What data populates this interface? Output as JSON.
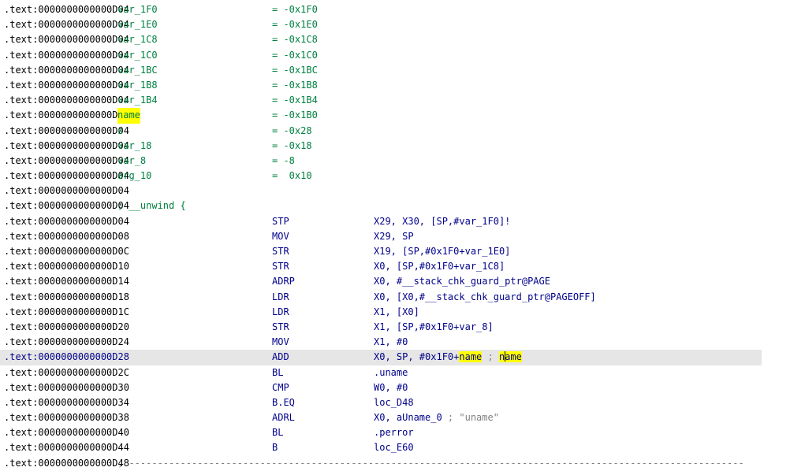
{
  "highlight_term": "name",
  "colors": {
    "address": "#000000",
    "symbol": "#008040",
    "instr": "#00008b",
    "comment": "#808080",
    "highlight": "#ffff00",
    "selection": "#e6e6e6"
  },
  "vars": [
    {
      "addr": ".text:0000000000000D04",
      "name": "var_1F0",
      "eq": "= -0x1F0"
    },
    {
      "addr": ".text:0000000000000D04",
      "name": "var_1E0",
      "eq": "= -0x1E0"
    },
    {
      "addr": ".text:0000000000000D04",
      "name": "var_1C8",
      "eq": "= -0x1C8"
    },
    {
      "addr": ".text:0000000000000D04",
      "name": "var_1C0",
      "eq": "= -0x1C0"
    },
    {
      "addr": ".text:0000000000000D04",
      "name": "var_1BC",
      "eq": "= -0x1BC"
    },
    {
      "addr": ".text:0000000000000D04",
      "name": "var_1B8",
      "eq": "= -0x1B8"
    },
    {
      "addr": ".text:0000000000000D04",
      "name": "var_1B4",
      "eq": "= -0x1B4"
    },
    {
      "addr": ".text:0000000000000D04",
      "name": "name",
      "eq": "= -0x1B0"
    },
    {
      "addr": ".text:0000000000000D04",
      "name": "s",
      "eq": "= -0x28"
    },
    {
      "addr": ".text:0000000000000D04",
      "name": "var_18",
      "eq": "= -0x18"
    },
    {
      "addr": ".text:0000000000000D04",
      "name": "var_8",
      "eq": "= -8"
    },
    {
      "addr": ".text:0000000000000D04",
      "name": "arg_10",
      "eq": "=  0x10"
    }
  ],
  "blank_addr": ".text:0000000000000D04",
  "unwind": {
    "addr": ".text:0000000000000D04",
    "text": "; __unwind {"
  },
  "instructions": [
    {
      "addr": ".text:0000000000000D04",
      "mn": "STP",
      "op": "X29, X30, [SP,#var_1F0]!"
    },
    {
      "addr": ".text:0000000000000D08",
      "mn": "MOV",
      "op": "X29, SP"
    },
    {
      "addr": ".text:0000000000000D0C",
      "mn": "STR",
      "op": "X19, [SP,#0x1F0+var_1E0]"
    },
    {
      "addr": ".text:0000000000000D10",
      "mn": "STR",
      "op": "X0, [SP,#0x1F0+var_1C8]"
    },
    {
      "addr": ".text:0000000000000D14",
      "mn": "ADRP",
      "op": "X0, #__stack_chk_guard_ptr@PAGE"
    },
    {
      "addr": ".text:0000000000000D18",
      "mn": "LDR",
      "op": "X0, [X0,#__stack_chk_guard_ptr@PAGEOFF]"
    },
    {
      "addr": ".text:0000000000000D1C",
      "mn": "LDR",
      "op": "X1, [X0]"
    },
    {
      "addr": ".text:0000000000000D20",
      "mn": "STR",
      "op": "X1, [SP,#0x1F0+var_8]"
    },
    {
      "addr": ".text:0000000000000D24",
      "mn": "MOV",
      "op": "X1, #0"
    },
    {
      "addr": ".text:0000000000000D28",
      "mn": "ADD",
      "op": "X0, SP, #0x1F0+",
      "op_hl": "name",
      "op_tail": " ; ",
      "cmt_hl": "name",
      "selected": true
    },
    {
      "addr": ".text:0000000000000D2C",
      "mn": "BL",
      "op": ".uname"
    },
    {
      "addr": ".text:0000000000000D30",
      "mn": "CMP",
      "op": "W0, #0"
    },
    {
      "addr": ".text:0000000000000D34",
      "mn": "B.EQ",
      "op": "loc_D48"
    },
    {
      "addr": ".text:0000000000000D38",
      "mn": "ADRL",
      "op": "X0, aUname_0",
      "comment": " ; \"uname\""
    },
    {
      "addr": ".text:0000000000000D40",
      "mn": "BL",
      "op": ".perror"
    },
    {
      "addr": ".text:0000000000000D44",
      "mn": "B",
      "op": "loc_E60"
    }
  ],
  "separator": {
    "addr": ".text:0000000000000D48",
    "text": "; ------------------------------------------------------------------------------------------------------------"
  }
}
